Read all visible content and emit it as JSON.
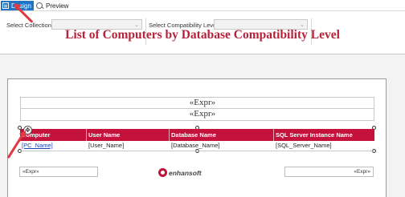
{
  "tabs": {
    "design_label": "Design",
    "preview_label": "Preview"
  },
  "parameters": {
    "collection_label": "Select Collection",
    "collection_value": "",
    "compat_label": "Select Compatibility Level",
    "compat_value": ""
  },
  "report": {
    "title": "List of Computers by Database Compatibility Level",
    "expr1": "«Expr»",
    "expr2": "«Expr»",
    "columns": [
      "Computer",
      "User Name",
      "Database Name",
      "SQL Server Instance Name"
    ],
    "row_fields": [
      "[PC_Name]",
      "[User_Name]",
      "[Database_Name]",
      "[SQL_Server_Name]"
    ],
    "footer_left": "«Expr»",
    "footer_right": "«Expr»",
    "logo_text": "enhansoft"
  },
  "colors": {
    "accent": "#c5123c",
    "tab_active": "#1f74c4",
    "annotation_arrow": "#e23a43"
  }
}
